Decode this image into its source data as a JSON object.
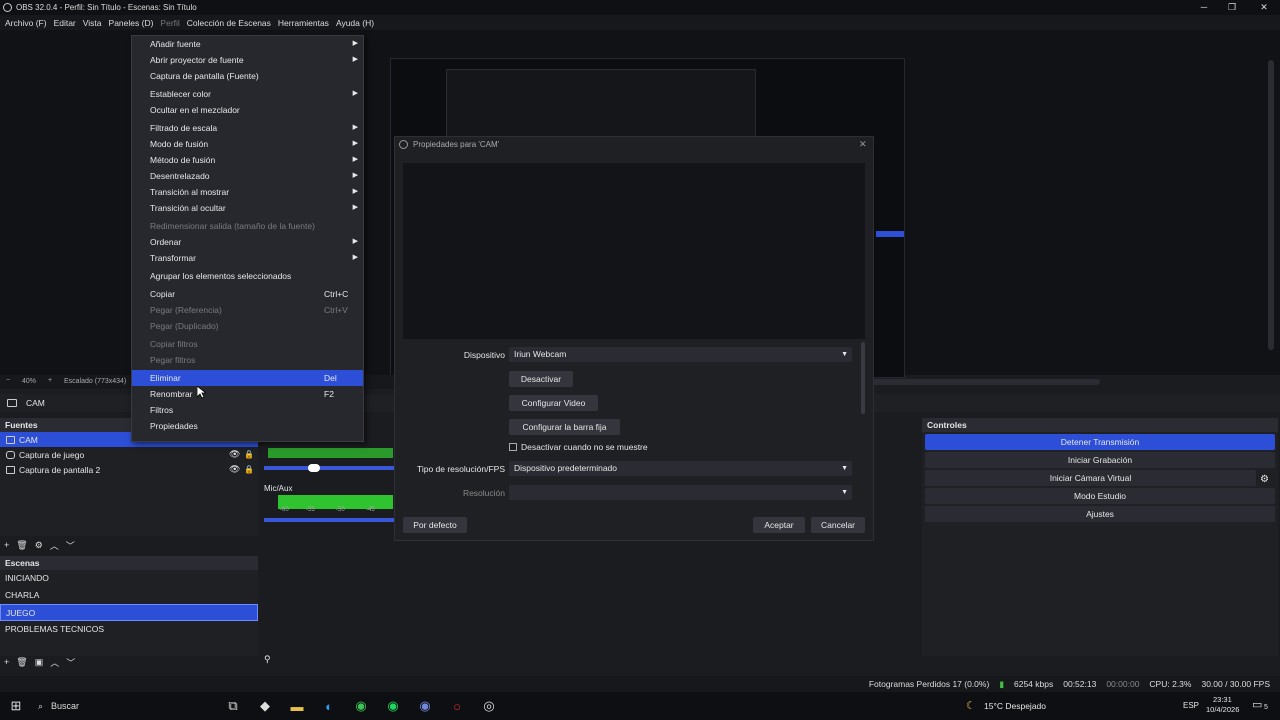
{
  "window": {
    "title": "OBS 32.0.4 - Perfil: Sin Título - Escenas: Sin Título",
    "minimize": "─",
    "maximize": "❐",
    "close": "✕"
  },
  "menubar": [
    {
      "label": "Archivo (F)",
      "enabled": true
    },
    {
      "label": "Editar",
      "enabled": true
    },
    {
      "label": "Vista",
      "enabled": true
    },
    {
      "label": "Paneles (D)",
      "enabled": true
    },
    {
      "label": "Perfil",
      "enabled": false
    },
    {
      "label": "Colección de Escenas",
      "enabled": true
    },
    {
      "label": "Herramientas",
      "enabled": true
    },
    {
      "label": "Ayuda (H)",
      "enabled": true
    }
  ],
  "zoom": {
    "level": "40%",
    "scale_text": "Escalado (773x434)"
  },
  "source_bar": {
    "name": "CAM"
  },
  "context_menu": {
    "items": [
      {
        "label": "Añadir fuente",
        "submenu": true
      },
      {
        "label": "Abrir proyector de fuente",
        "submenu": true
      },
      {
        "label": "Captura de pantalla (Fuente)"
      },
      {
        "sep": true
      },
      {
        "label": "Establecer color",
        "submenu": true
      },
      {
        "label": "Ocultar en el mezclador"
      },
      {
        "sep": true
      },
      {
        "label": "Filtrado de escala",
        "submenu": true
      },
      {
        "label": "Modo de fusión",
        "submenu": true
      },
      {
        "label": "Método de fusión",
        "submenu": true
      },
      {
        "label": "Desentrelazado",
        "submenu": true
      },
      {
        "label": "Transición al mostrar",
        "submenu": true
      },
      {
        "label": "Transición al ocultar",
        "submenu": true
      },
      {
        "sep": true
      },
      {
        "label": "Redimensionar salida (tamaño de la fuente)",
        "disabled": true
      },
      {
        "label": "Ordenar",
        "submenu": true
      },
      {
        "label": "Transformar",
        "submenu": true
      },
      {
        "sep": true
      },
      {
        "label": "Agrupar los elementos seleccionados"
      },
      {
        "sep": true
      },
      {
        "label": "Copiar",
        "shortcut": "Ctrl+C"
      },
      {
        "label": "Pegar (Referencia)",
        "shortcut": "Ctrl+V",
        "disabled": true
      },
      {
        "label": "Pegar (Duplicado)",
        "disabled": true
      },
      {
        "sep": true
      },
      {
        "label": "Copiar filtros",
        "disabled": true
      },
      {
        "label": "Pegar filtros",
        "disabled": true
      },
      {
        "sep": true
      },
      {
        "label": "Eliminar",
        "shortcut": "Del",
        "selected": true
      },
      {
        "label": "Renombrar",
        "shortcut": "F2"
      },
      {
        "label": "Filtros"
      },
      {
        "label": "Propiedades"
      }
    ]
  },
  "sources": {
    "title": "Fuentes",
    "items": [
      {
        "label": "CAM",
        "selected": true
      },
      {
        "label": "Captura de juego",
        "selected": false
      },
      {
        "label": "Captura de pantalla 2",
        "selected": false
      }
    ]
  },
  "scenes": {
    "title": "Escenas",
    "items": [
      {
        "label": "INICIANDO",
        "selected": false
      },
      {
        "label": "CHARLA",
        "selected": false
      },
      {
        "label": "JUEGO",
        "selected": true
      },
      {
        "label": "PROBLEMAS TECNICOS",
        "selected": false
      }
    ]
  },
  "mixer": {
    "channel2": "Mic/Aux",
    "ticks": [
      "-60",
      "-55",
      "-50",
      "-45"
    ]
  },
  "controls": {
    "title": "Controles",
    "buttons": [
      {
        "label": "Detener Transmisión",
        "active": true
      },
      {
        "label": "Iniciar Grabación",
        "active": false
      },
      {
        "label": "Iniciar Cámara Virtual",
        "active": false
      },
      {
        "label": "Modo Estudio",
        "active": false
      },
      {
        "label": "Ajustes",
        "active": false
      }
    ]
  },
  "dialog": {
    "title": "Propiedades para 'CAM'",
    "device_label": "Dispositivo",
    "device_value": "Iriun Webcam",
    "btn_deactivate": "Desactivar",
    "btn_config_video": "Configurar Video",
    "btn_config_bar": "Configurar la barra fija",
    "checkbox_label": "Desactivar cuando no se muestre",
    "res_type_label": "Tipo de resolución/FPS",
    "res_type_value": "Dispositivo predeterminado",
    "resolution_label": "Resolución",
    "resolution_value": "",
    "btn_defaults": "Por defecto",
    "btn_accept": "Aceptar",
    "btn_cancel": "Cancelar"
  },
  "status": {
    "dropped": "Fotogramas Perdidos 17 (0.0%)",
    "bitrate": "6254 kbps",
    "stream_time": "00:52:13",
    "rec_time": "00:00:00",
    "cpu": "CPU: 2.3%",
    "fps": "30.00 / 30.00 FPS"
  },
  "taskbar": {
    "search_placeholder": "Buscar",
    "weather": "15°C  Despejado",
    "lang": "ESP",
    "time": "23:31",
    "date": "10/4/2026",
    "notif_count": "5"
  },
  "colors": {
    "accent": "#2d4fd8",
    "panel": "#1f2024",
    "background": "#1b1c20"
  }
}
